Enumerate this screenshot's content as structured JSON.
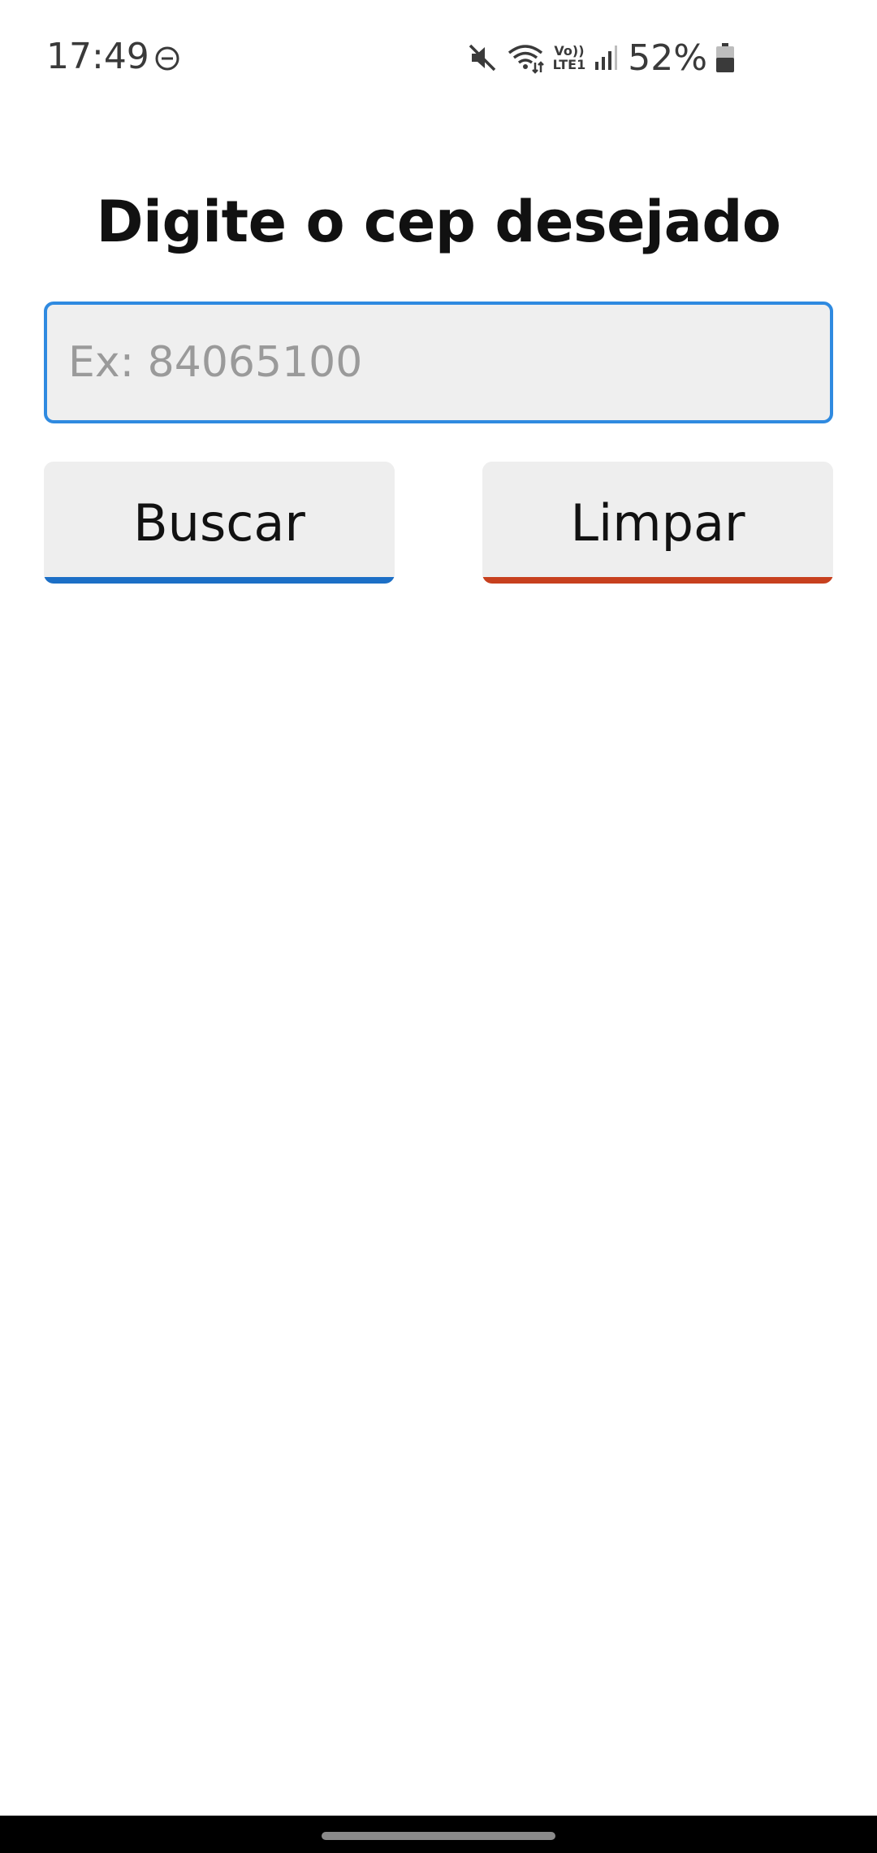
{
  "status_bar": {
    "time": "17:49",
    "battery_percent": "52%",
    "volte_line1": "Vo))",
    "volte_line2": "LTE1",
    "icons": [
      "do-not-disturb-icon",
      "mute-icon",
      "wifi-icon",
      "volte-icon",
      "signal-icon",
      "battery-icon"
    ]
  },
  "main": {
    "title": "Digite o cep desejado",
    "cep_input": {
      "value": "",
      "placeholder": "Ex: 84065100"
    },
    "search_button_label": "Buscar",
    "clear_button_label": "Limpar"
  },
  "colors": {
    "input_border": "#2f8ae0",
    "search_accent": "#1c6fc6",
    "clear_accent": "#c7401e",
    "button_bg": "#eeeeee"
  }
}
